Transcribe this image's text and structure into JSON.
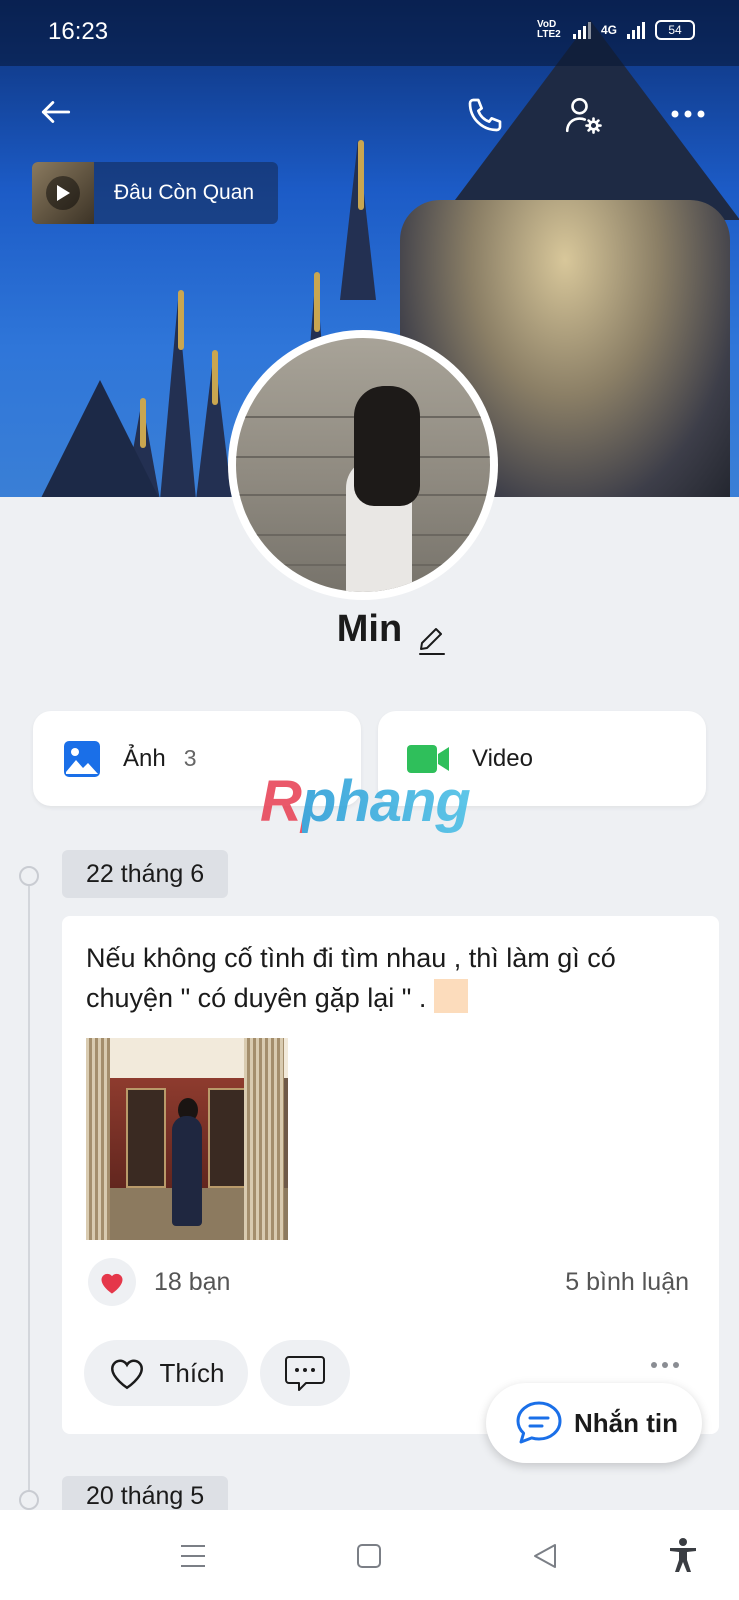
{
  "status_bar": {
    "time": "16:23",
    "volte_label": "VoD LTE2",
    "network_label": "4G",
    "battery": "54"
  },
  "header": {
    "back_icon": "arrow-left-icon",
    "call_icon": "phone-icon",
    "settings_icon": "user-settings-icon",
    "more_icon": "more-horizontal-icon"
  },
  "music": {
    "title": "Đâu Còn Quan"
  },
  "profile": {
    "name": "Min"
  },
  "media": {
    "photos_label": "Ảnh",
    "photos_count": "3",
    "videos_label": "Video"
  },
  "watermark": "Rphang",
  "feed": {
    "posts": [
      {
        "date": "22 tháng 6",
        "text": "Nếu không cố tình đi tìm nhau , thì làm gì có chuyện \" có duyên gặp lại \" . ",
        "likes": "18 bạn",
        "comments": "5 bình luận",
        "like_button": "Thích"
      }
    ],
    "next_date": "20 tháng 5"
  },
  "fab": {
    "label": "Nhắn tin"
  },
  "colors": {
    "accent": "#1a6fe8",
    "heart": "#e5374a",
    "video": "#2fbf5b",
    "background": "#eef0f3"
  }
}
